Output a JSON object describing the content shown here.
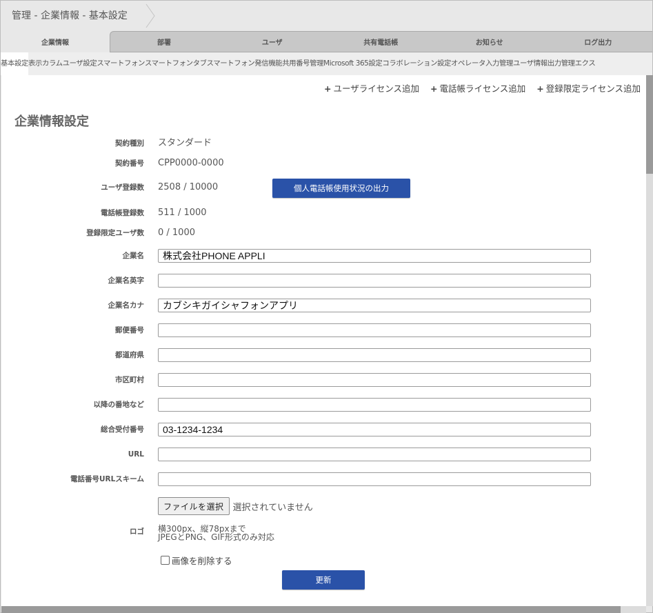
{
  "breadcrumb": {
    "text": "管理 - 企業情報 - 基本設定"
  },
  "tabs": [
    {
      "label": "企業情報",
      "active": true
    },
    {
      "label": "部署",
      "active": false
    },
    {
      "label": "ユーザ",
      "active": false
    },
    {
      "label": "共有電話帳",
      "active": false
    },
    {
      "label": "お知らせ",
      "active": false
    },
    {
      "label": "ログ出力",
      "active": false
    }
  ],
  "subtabs": [
    {
      "label": "基本設定",
      "active": true
    },
    {
      "label": "表示カラム",
      "active": false
    },
    {
      "label": "ユーザ設定",
      "active": false
    },
    {
      "label": "スマートフォン",
      "active": false
    },
    {
      "label": "スマートフォンタブ",
      "active": false
    },
    {
      "label": "スマートフォン発信機能",
      "active": false
    },
    {
      "label": "共用番号管理",
      "active": false
    },
    {
      "label": "Microsoft 365設定",
      "active": false
    },
    {
      "label": "コラボレーション設定",
      "active": false
    },
    {
      "label": "オペレータ入力管理",
      "active": false
    },
    {
      "label": "ユーザ情報出力管理",
      "active": false
    },
    {
      "label": "エクス",
      "active": false
    }
  ],
  "license_links": [
    {
      "label": "ユーザライセンス追加"
    },
    {
      "label": "電話帳ライセンス追加"
    },
    {
      "label": "登録限定ライセンス追加"
    }
  ],
  "section_title": "企業情報設定",
  "info": [
    {
      "label": "契約種別",
      "value": "スタンダード"
    },
    {
      "label": "契約番号",
      "value": "CPP0000-0000"
    },
    {
      "label": "ユーザ登録数",
      "value": "2508 / 10000"
    },
    {
      "label": "電話帳登録数",
      "value": "511 / 1000"
    },
    {
      "label": "登録限定ユーザ数",
      "value": "0 / 1000"
    }
  ],
  "export_button": "個人電話帳使用状況の出力",
  "fields": [
    {
      "label": "企業名",
      "value": "株式会社PHONE APPLI"
    },
    {
      "label": "企業名英字",
      "value": ""
    },
    {
      "label": "企業名カナ",
      "value": "カブシキガイシャフォンアプリ"
    },
    {
      "label": "郵便番号",
      "value": ""
    },
    {
      "label": "都道府県",
      "value": ""
    },
    {
      "label": "市区町村",
      "value": ""
    },
    {
      "label": "以降の番地など",
      "value": ""
    },
    {
      "label": "総合受付番号",
      "value": "03-1234-1234"
    },
    {
      "label": "URL",
      "value": ""
    },
    {
      "label": "電話番号URLスキーム",
      "value": ""
    }
  ],
  "logo": {
    "label": "ロゴ",
    "file_button": "ファイルを選択",
    "file_status": "選択されていません",
    "note_line1": "横300px、縦78pxまで",
    "note_line2": "JPEGとPNG、GIF形式のみ対応",
    "delete_checkbox_label": "画像を削除する",
    "delete_checked": false
  },
  "update_button": "更新",
  "colors": {
    "primary_button": "#2a52a8",
    "tab_inactive_bg": "#c8c8c8",
    "header_bg": "#e8e8e8"
  }
}
